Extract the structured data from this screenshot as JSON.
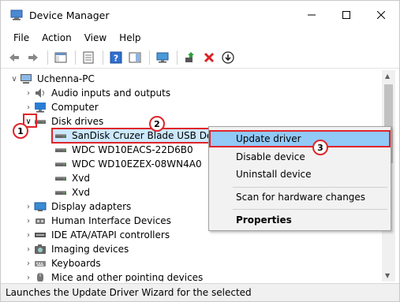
{
  "window": {
    "title": "Device Manager"
  },
  "menu": [
    "File",
    "Action",
    "View",
    "Help"
  ],
  "toolbar": [
    "back-icon",
    "forward-icon",
    "properties-pane-icon",
    "show-hide-console-tree-icon",
    "help-icon",
    "action-pane-icon",
    "monitor-icon",
    "update-driver-icon",
    "uninstall-icon",
    "disable-icon"
  ],
  "tree": {
    "root": "Uchenna-PC",
    "items": [
      {
        "label": "Audio inputs and outputs",
        "icon": "speaker-icon",
        "expander": "collapsed"
      },
      {
        "label": "Computer",
        "icon": "computer-icon",
        "expander": "collapsed"
      },
      {
        "label": "Disk drives",
        "icon": "disk-icon",
        "expander": "expanded"
      }
    ],
    "disks": [
      "SanDisk Cruzer Blade USB Device",
      "WDC WD10EACS-22D6B0",
      "WDC WD10EZEX-08WN4A0",
      "Xvd",
      "Xvd"
    ],
    "more": [
      {
        "label": "Display adapters",
        "icon": "display-icon"
      },
      {
        "label": "Human Interface Devices",
        "icon": "hid-icon"
      },
      {
        "label": "IDE ATA/ATAPI controllers",
        "icon": "ide-icon"
      },
      {
        "label": "Imaging devices",
        "icon": "camera-icon"
      },
      {
        "label": "Keyboards",
        "icon": "keyboard-icon"
      },
      {
        "label": "Mice and other pointing devices",
        "icon": "mouse-icon"
      }
    ]
  },
  "context_menu": {
    "update": "Update driver",
    "disable": "Disable device",
    "uninstall": "Uninstall device",
    "scan": "Scan for hardware changes",
    "properties": "Properties"
  },
  "status": "Launches the Update Driver Wizard for the selected",
  "badges": {
    "one": "1",
    "two": "2",
    "three": "3"
  },
  "colors": {
    "accent": "#e0242a",
    "selection": "#cce8ff",
    "menu_highlight": "#91c9f7"
  }
}
